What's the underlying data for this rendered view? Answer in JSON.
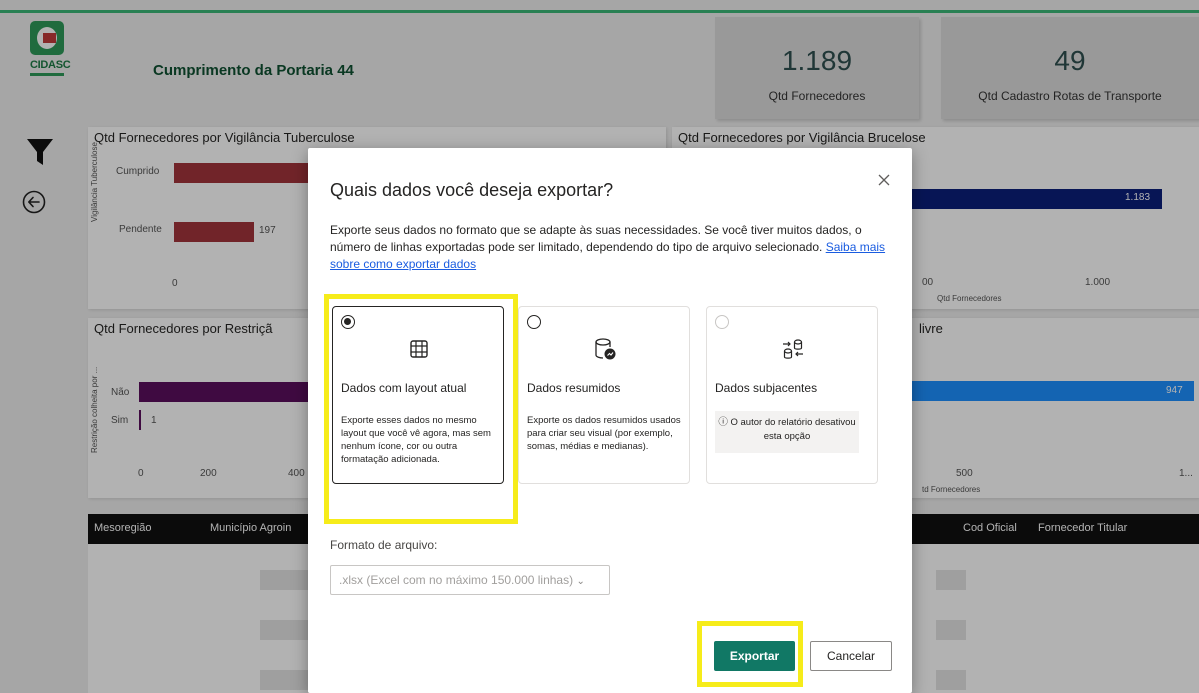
{
  "header": {
    "logo_text": "CIDASC",
    "title": "Cumprimento da Portaria 44",
    "kpis": [
      {
        "value": "1.189",
        "label": "Qtd Fornecedores"
      },
      {
        "value": "49",
        "label": "Qtd Cadastro Rotas de Transporte"
      }
    ]
  },
  "cards": {
    "tuberculose": {
      "title": "Qtd Fornecedores por Vigilância Tuberculose",
      "axis_label": "Vigilância Tuberculose",
      "categories": [
        "Cumprido",
        "Pendente"
      ],
      "pendente_value": "197",
      "x_tick": "0",
      "bar_color": "#a3343b"
    },
    "brucelose": {
      "title": "Qtd Fornecedores por Vigilância Brucelose",
      "value": "1.183",
      "x_ticks": [
        "00",
        "1.000"
      ],
      "x_label": "Qtd Fornecedores",
      "bar_color": "#0b1f7a"
    },
    "restricao": {
      "title": "Qtd Fornecedores por Restriçã",
      "axis_label": "Restrição colheita por ...",
      "categories": [
        "Não",
        "Sim"
      ],
      "sim_value": "1",
      "x_ticks": [
        "0",
        "200",
        "400"
      ],
      "bar_color": "#5b0f5e"
    },
    "livre": {
      "title": "livre",
      "value": "947",
      "x_ticks": [
        "500",
        "1..."
      ],
      "x_label": "td Fornecedores",
      "bar_color": "#1e90ff"
    }
  },
  "table": {
    "columns": [
      "Mesoregião",
      "Município Agroin",
      "Cod Oficial",
      "Fornecedor Titular"
    ]
  },
  "dialog": {
    "title": "Quais dados você deseja exportar?",
    "description": "Exporte seus dados no formato que se adapte às suas necessidades. Se você tiver muitos dados, o número de linhas exportadas pode ser limitado, dependendo do tipo de arquivo selecionado.",
    "link": "Saiba mais sobre como exportar dados",
    "options": [
      {
        "title": "Dados com layout atual",
        "text": "Exporte esses dados no mesmo layout que você vê agora, mas sem nenhum ícone, cor ou outra formatação adicionada.",
        "icon": "table-icon",
        "selected": true
      },
      {
        "title": "Dados resumidos",
        "text": "Exporte os dados resumidos usados para criar seu visual (por exemplo, somas, médias e medianas).",
        "icon": "database-chart-icon",
        "selected": false
      },
      {
        "title": "Dados subjacentes",
        "note_icon": "ⓘ",
        "note": "O autor do relatório desativou esta opção",
        "icon": "data-swap-icon",
        "selected": false
      }
    ],
    "format_label": "Formato de arquivo:",
    "format_value": ".xlsx (Excel com no máximo 150.000 linhas)",
    "export_label": "Exportar",
    "cancel_label": "Cancelar",
    "highlight_color": "#f6ec1a",
    "accent_color": "#117865"
  }
}
